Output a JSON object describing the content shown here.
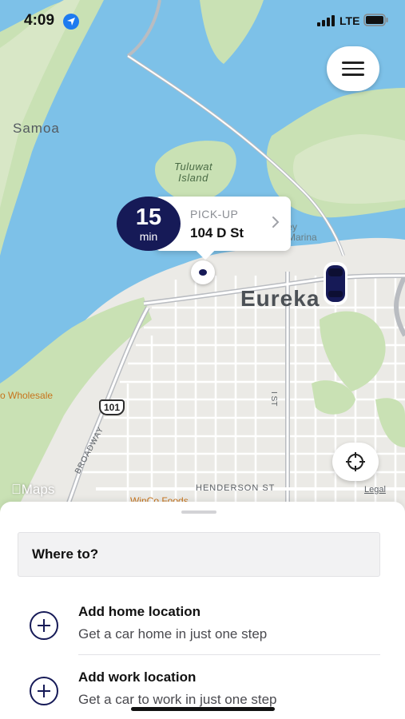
{
  "status_bar": {
    "time": "4:09",
    "network": "LTE"
  },
  "map": {
    "labels": {
      "samoa": "Samoa",
      "island_line1": "Tuluwat",
      "island_line2": "Island",
      "city": "Eureka",
      "wholesale": "o Wholesale",
      "marina_line1": "dley",
      "marina_line2": "d Marina",
      "street_i": "I ST",
      "broadway": "BROADWAY",
      "henderson": "HENDERSON ST",
      "winco": "WinCo Foods",
      "shield": "101",
      "maps_brand": "Maps",
      "legal": "Legal"
    },
    "colors": {
      "water": "#7dc1e8",
      "land": "#ebeae6",
      "park": "#c9e1b4",
      "road": "#ffffff",
      "highway": "#b9bcc1"
    }
  },
  "pickup": {
    "eta_value": "15",
    "eta_unit": "min",
    "label": "PICK-UP",
    "address": "104 D St"
  },
  "sheet": {
    "search_placeholder": "Where to?",
    "home": {
      "title": "Add home location",
      "subtitle": "Get a car home in just one step"
    },
    "work": {
      "title": "Add work location",
      "subtitle": "Get a car to work in just one step"
    }
  },
  "colors": {
    "accent": "#161a57",
    "ios_blue": "#1e7bf0"
  }
}
